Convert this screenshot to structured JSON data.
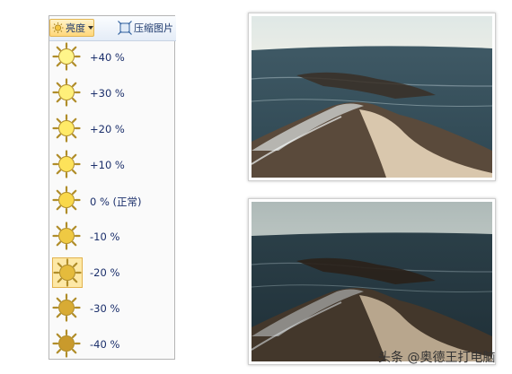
{
  "toolbar": {
    "brightness_label": "亮度",
    "compress_label": "压缩图片"
  },
  "brightness_options": [
    {
      "label": "+40 %",
      "color": "#fff58a"
    },
    {
      "label": "+30 %",
      "color": "#fff07a"
    },
    {
      "label": "+20 %",
      "color": "#ffea68"
    },
    {
      "label": "+10 %",
      "color": "#fde25a"
    },
    {
      "label": "0 % (正常)",
      "color": "#f9d84b"
    },
    {
      "label": "-10 %",
      "color": "#efc943"
    },
    {
      "label": "-20 %",
      "color": "#e5bb3c",
      "selected": true
    },
    {
      "label": "-30 %",
      "color": "#d8ab34"
    },
    {
      "label": "-40 %",
      "color": "#c99a2c"
    }
  ],
  "photos": {
    "original": {
      "sky": "#e9ece6",
      "sea": "#3f5965"
    },
    "adjusted": {
      "sky": "#b9c3c0",
      "sea": "#2b3f48"
    }
  },
  "watermark": "头条 @奥德王打电脑"
}
